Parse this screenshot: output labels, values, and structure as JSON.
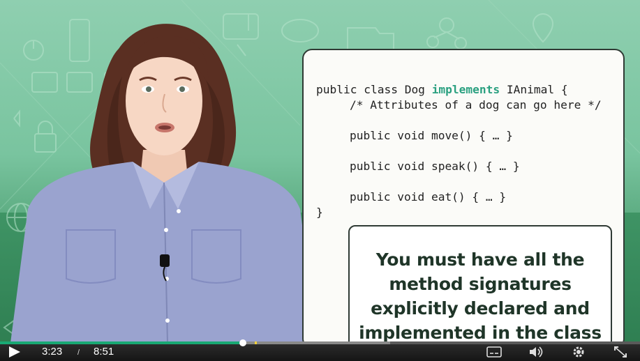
{
  "video": {
    "code_lines": [
      {
        "indent": 0,
        "parts": [
          {
            "t": "public class Dog "
          },
          {
            "t": "implements",
            "kw": true
          },
          {
            "t": " IAnimal {"
          }
        ]
      },
      {
        "indent": 1,
        "parts": [
          {
            "t": "/* Attributes of a dog can go here */"
          }
        ]
      },
      {
        "indent": 0,
        "parts": [
          {
            "t": ""
          }
        ]
      },
      {
        "indent": 1,
        "parts": [
          {
            "t": "public void move() { … }"
          }
        ]
      },
      {
        "indent": 0,
        "parts": [
          {
            "t": ""
          }
        ]
      },
      {
        "indent": 1,
        "parts": [
          {
            "t": "public void speak() { … }"
          }
        ]
      },
      {
        "indent": 0,
        "parts": [
          {
            "t": ""
          }
        ]
      },
      {
        "indent": 1,
        "parts": [
          {
            "t": "public void eat() { … }"
          }
        ]
      },
      {
        "indent": 0,
        "parts": [
          {
            "t": "}"
          }
        ]
      }
    ],
    "note_lines": [
      "You must have all the",
      "method signatures",
      "explicitly declared and",
      "implemented in the class"
    ]
  },
  "player": {
    "current_time": "3:23",
    "separator": "/",
    "duration": "8:51",
    "progress_fraction": 0.38,
    "buffered_fraction": 0.61,
    "marker_fraction": 0.398,
    "colors": {
      "played": "#19a974",
      "accent": "#2aa080"
    },
    "icons": [
      "play-icon",
      "captions-icon",
      "volume-icon",
      "settings-icon",
      "fullscreen-icon"
    ]
  }
}
